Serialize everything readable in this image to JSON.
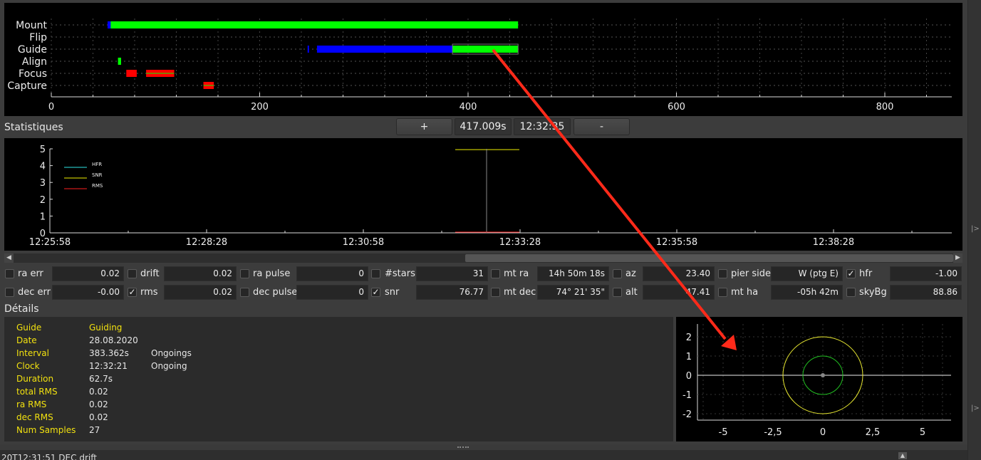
{
  "timeline": {
    "rows": [
      "Mount",
      "Flip",
      "Guide",
      "Align",
      "Focus",
      "Capture"
    ],
    "ticks": [
      "0",
      "200",
      "400",
      "600",
      "800"
    ],
    "segments": [
      {
        "row": "Mount",
        "start": 55,
        "end": 448,
        "color": "#00ff00"
      },
      {
        "row": "Mount",
        "start": 54,
        "end": 57,
        "color": "#0000ff"
      },
      {
        "row": "Guide",
        "start": 246,
        "end": 247,
        "color": "#0000ff"
      },
      {
        "row": "Guide",
        "start": 255,
        "end": 385,
        "color": "#0000ff"
      },
      {
        "row": "Guide",
        "start": 385,
        "end": 448,
        "color": "#00ff00"
      },
      {
        "row": "Align",
        "start": 64,
        "end": 67,
        "color": "#00ff00"
      },
      {
        "row": "Focus",
        "start": 72,
        "end": 82,
        "color": "#ff0000"
      },
      {
        "row": "Focus",
        "start": 91,
        "end": 118,
        "color": "#ff0000"
      },
      {
        "row": "Capture",
        "start": 146,
        "end": 156,
        "color": "#ff0000"
      }
    ]
  },
  "statistics_bar": {
    "title": "Statistiques",
    "plus_label": "+",
    "time_label": "417.009s",
    "clock_label": "12:32:35",
    "minus_label": "-"
  },
  "stats_chart": {
    "y_ticks": [
      "0",
      "1",
      "2",
      "3",
      "4",
      "5"
    ],
    "x_ticks": [
      "12:25:58",
      "12:28:28",
      "12:30:58",
      "12:33:28",
      "12:35:58",
      "12:38:28"
    ],
    "legend": [
      {
        "name": "HFR",
        "color": "#2ee6e6"
      },
      {
        "name": "SNR",
        "color": "#f0f000"
      },
      {
        "name": "RMS",
        "color": "#ff2020"
      }
    ]
  },
  "fields": [
    {
      "name": "ra err",
      "checked": false,
      "value": "0.02"
    },
    {
      "name": "drift",
      "checked": false,
      "value": "0.02"
    },
    {
      "name": "ra pulse",
      "checked": false,
      "value": "0"
    },
    {
      "name": "#stars",
      "checked": false,
      "value": "31"
    },
    {
      "name": "mt ra",
      "checked": false,
      "value": "14h 50m 18s"
    },
    {
      "name": "az",
      "checked": false,
      "value": "23.40"
    },
    {
      "name": "pier side",
      "checked": false,
      "value": "W (ptg E)"
    },
    {
      "name": "hfr",
      "checked": true,
      "value": "-1.00"
    },
    {
      "name": "dec err",
      "checked": false,
      "value": "-0.00"
    },
    {
      "name": "rms",
      "checked": true,
      "value": "0.02"
    },
    {
      "name": "dec pulse",
      "checked": false,
      "value": "0"
    },
    {
      "name": "snr",
      "checked": true,
      "value": "76.77"
    },
    {
      "name": "mt dec",
      "checked": false,
      "value": "74° 21' 35\""
    },
    {
      "name": "alt",
      "checked": false,
      "value": "47.41"
    },
    {
      "name": "mt ha",
      "checked": false,
      "value": "-05h 42m"
    },
    {
      "name": "skyBg",
      "checked": false,
      "value": "88.86"
    }
  ],
  "details": {
    "title": "Détails",
    "rows": [
      {
        "key": "Guide",
        "value": "Guiding",
        "extra": ""
      },
      {
        "key": "Date",
        "value": "28.08.2020",
        "extra": ""
      },
      {
        "key": "Interval",
        "value": "383.362s",
        "extra": "Ongoings"
      },
      {
        "key": "Clock",
        "value": "12:32:21",
        "extra": "Ongoing"
      },
      {
        "key": "Duration",
        "value": "62.7s",
        "extra": ""
      },
      {
        "key": "total RMS",
        "value": "0.02",
        "extra": ""
      },
      {
        "key": "ra RMS",
        "value": "0.02",
        "extra": ""
      },
      {
        "key": "dec RMS",
        "value": "0.02",
        "extra": ""
      },
      {
        "key": "Num Samples",
        "value": "27",
        "extra": ""
      }
    ]
  },
  "target_plot": {
    "x_ticks": [
      "-5",
      "-2,5",
      "0",
      "2,5",
      "5"
    ],
    "y_ticks": [
      "2",
      "1",
      "0",
      "-1",
      "-2"
    ]
  },
  "status_line": "20T12:31:51 DEC drift",
  "right_strip_arrows": [
    "|>",
    "|>"
  ]
}
